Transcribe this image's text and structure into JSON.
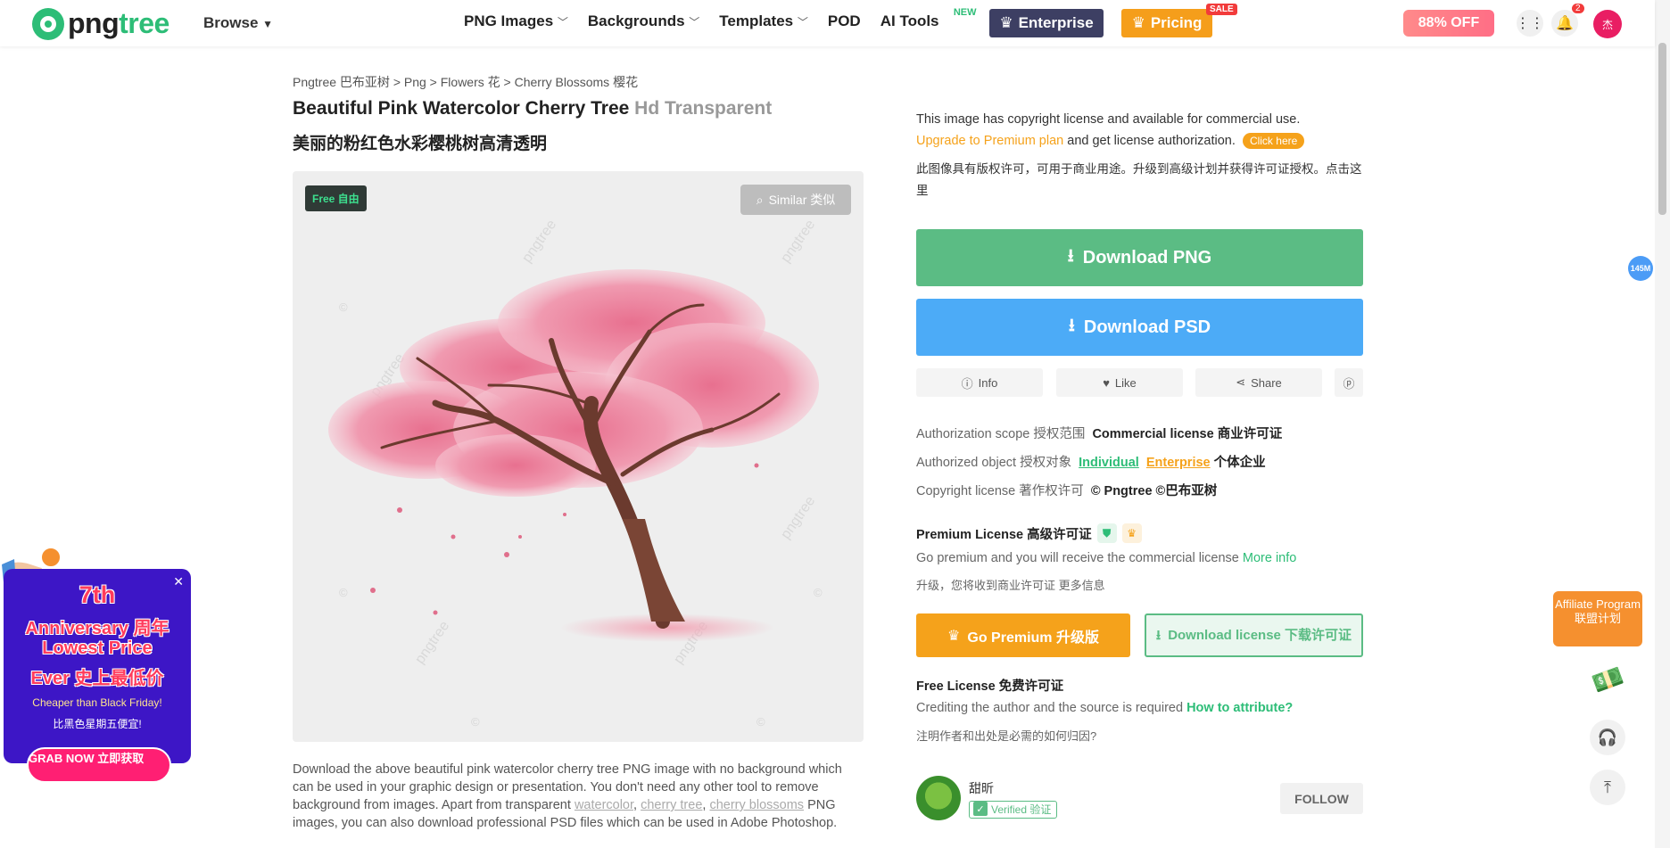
{
  "header": {
    "logo": {
      "part1": "png",
      "part2": "tree"
    },
    "browse": "Browse",
    "nav": [
      {
        "label": "PNG Images",
        "chevron": true
      },
      {
        "label": "Backgrounds",
        "chevron": true
      },
      {
        "label": "Templates",
        "chevron": true
      },
      {
        "label": "POD",
        "chevron": false
      },
      {
        "label": "AI Tools",
        "chevron": false,
        "badge": "NEW"
      }
    ],
    "enterprise": "Enterprise",
    "pricing": "Pricing",
    "sale": "SALE",
    "discount": "88% OFF",
    "notifications": "2",
    "avatar": "杰"
  },
  "breadcrumb": "Pngtree 巴布亚树 > Png > Flowers 花 > Cherry Blossoms 樱花",
  "title": {
    "main": "Beautiful Pink Watercolor Cherry Tree",
    "muted": "Hd Transparent",
    "cn": "美丽的粉红色水彩樱桃树高清透明"
  },
  "preview": {
    "free_tag": "Free 自由",
    "similar": "Similar 类似",
    "watermark": "pngtree",
    "copyright_mark": "©"
  },
  "description": {
    "text1": "Download the above beautiful pink watercolor cherry tree PNG image with no background which can be used in your graphic design or presentation. You don't need any other tool to remove background from images. Apart from transparent",
    "tags": [
      "watercolor",
      "cherry tree",
      "cherry blossoms"
    ],
    "text2": "PNG images, you can also download professional PSD files which can be used in Adobe Photoshop."
  },
  "copyright": {
    "line1": "This image has copyright license and available for commercial use.",
    "upgrade": "Upgrade to Premium plan",
    "line2": "and get license authorization.",
    "click_here": "Click here",
    "cn": "此图像具有版权许可，可用于商业用途。升级到高级计划并获得许可证授权。点击这里"
  },
  "downloads": {
    "png": "Download PNG",
    "psd": "Download PSD"
  },
  "actions": [
    {
      "label": "Info",
      "icon": "info-icon"
    },
    {
      "label": "Like",
      "icon": "heart-icon"
    },
    {
      "label": "Share",
      "icon": "share-icon"
    }
  ],
  "license": {
    "scope_label": "Authorization scope 授权范围",
    "scope_value": "Commercial license 商业许可证",
    "object_label": "Authorized object 授权对象",
    "individual": "Individual",
    "enterprise": "Enterprise",
    "object_cn": "个体企业",
    "copyright_label": "Copyright license 著作权许可",
    "copyright_value": "© Pngtree ©巴布亚树"
  },
  "premium": {
    "heading": "Premium License 高级许可证",
    "text": "Go premium and you will receive the commercial license",
    "more": "More info",
    "cn": "升级，您将收到商业许可证 更多信息",
    "go_button": "Go Premium 升级版",
    "license_button": "Download license 下载许可证"
  },
  "free_license": {
    "heading": "Free License 免费许可证",
    "text": "Crediting the author and the source is required",
    "link": "How to attribute?",
    "cn": "注明作者和出处是必需的如何归因?"
  },
  "author": {
    "name": "甜昕",
    "verified": "Verified 验证",
    "follow": "FOLLOW"
  },
  "floating": {
    "memory": "145M",
    "affiliate": "Affiliate Program 联盟计划"
  },
  "promo": {
    "headline": "7th",
    "line1": "Anniversary 周年",
    "line2": "Lowest Price",
    "line3": "Ever 史上最低价",
    "small1": "Cheaper than Black Friday!",
    "small2": "比黑色星期五便宜!",
    "cta": "GRAB NOW 立即获取"
  },
  "colors": {
    "brand_green": "#2dbd77",
    "download_png": "#5bbc84",
    "download_psd": "#4cabf7",
    "premium_orange": "#f5a21b",
    "enterprise": "#3d3f63",
    "promo_purple": "#3d16c6"
  }
}
